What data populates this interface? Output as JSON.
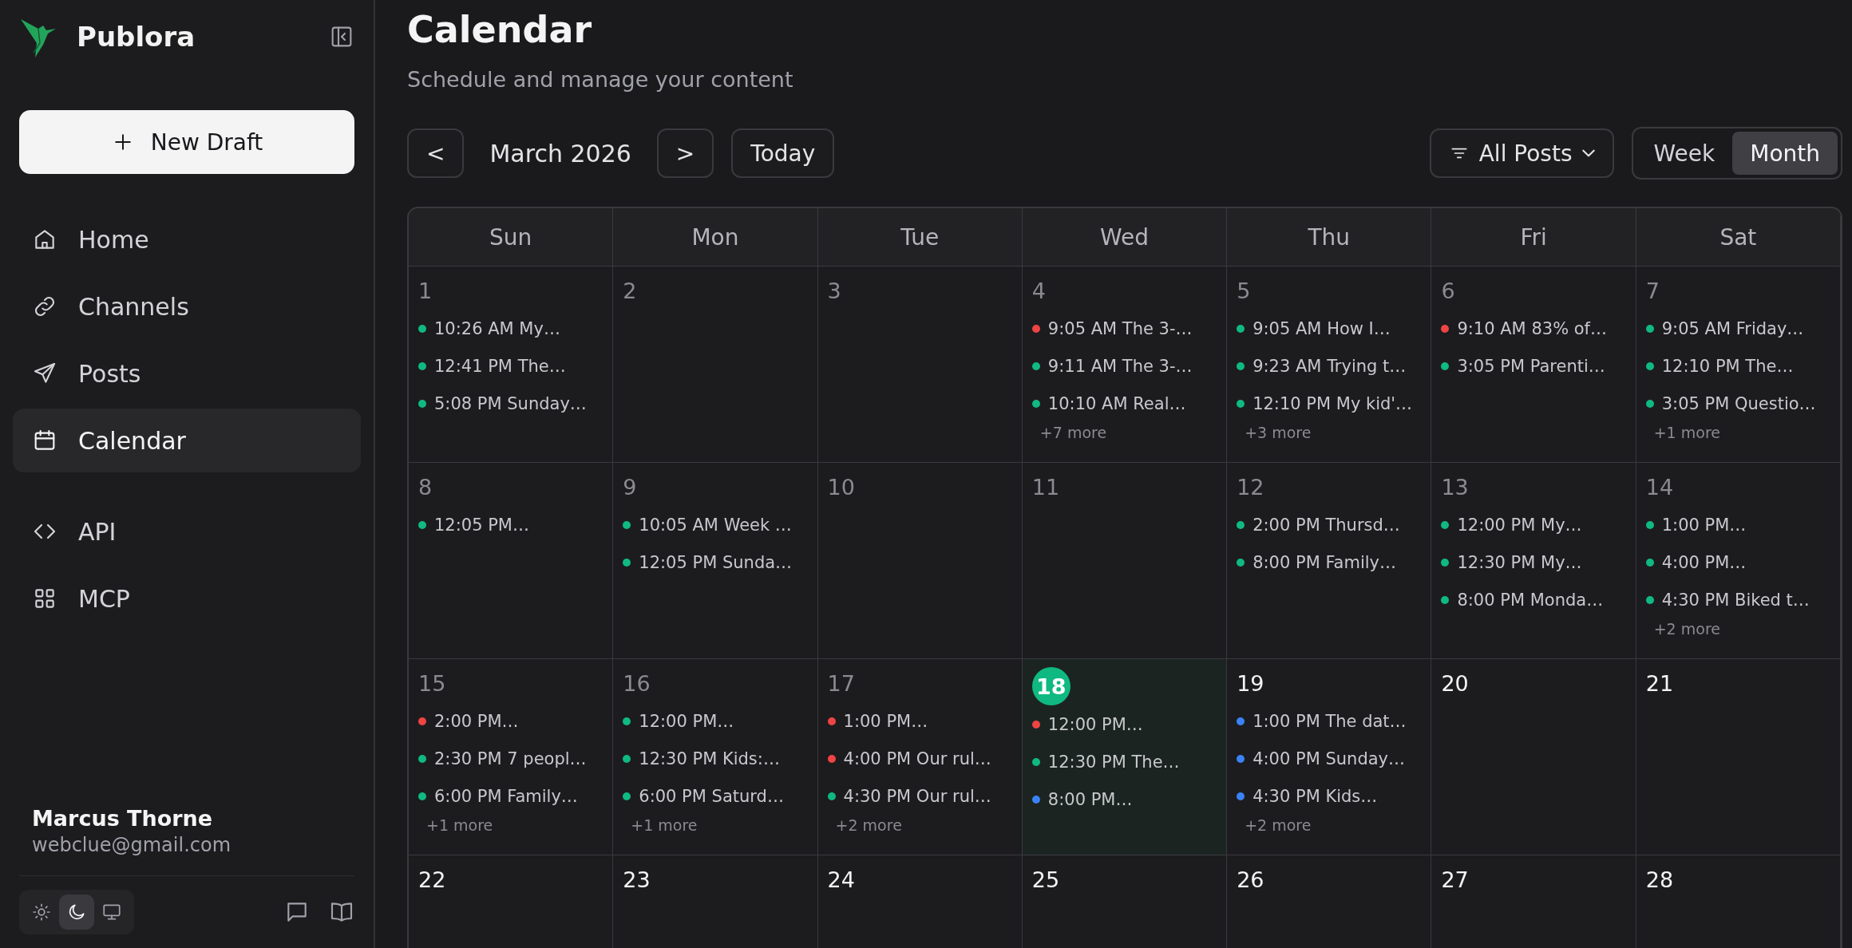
{
  "sidebar": {
    "brand": "Publora",
    "new_draft": "New Draft",
    "nav": [
      {
        "label": "Home",
        "selected": false
      },
      {
        "label": "Channels",
        "selected": false
      },
      {
        "label": "Posts",
        "selected": false
      },
      {
        "label": "Calendar",
        "selected": true
      },
      {
        "label": "API",
        "selected": false
      },
      {
        "label": "MCP",
        "selected": false
      }
    ],
    "user": {
      "name": "Marcus Thorne",
      "email": "webclue@gmail.com"
    },
    "theme_options": [
      {
        "selected": false
      },
      {
        "selected": true
      },
      {
        "selected": false
      }
    ]
  },
  "page": {
    "title": "Calendar",
    "subtitle": "Schedule and manage your content"
  },
  "toolbar": {
    "prev": "<",
    "month": "March 2026",
    "next": ">",
    "today": "Today",
    "filter": "All Posts",
    "views": [
      {
        "label": "Week",
        "selected": false
      },
      {
        "label": "Month",
        "selected": true
      }
    ]
  },
  "calendar": {
    "weekdays": [
      "Sun",
      "Mon",
      "Tue",
      "Wed",
      "Thu",
      "Fri",
      "Sat"
    ],
    "weeks": [
      [
        {
          "number": "1",
          "past": true,
          "today": false,
          "posts": [
            {
              "text": "10:26 AM My…",
              "color": "#10b981"
            },
            {
              "text": "12:41 PM The…",
              "color": "#10b981"
            },
            {
              "text": "5:08 PM Sunday…",
              "color": "#10b981"
            }
          ]
        },
        {
          "number": "2",
          "past": true,
          "today": false
        },
        {
          "number": "3",
          "past": true,
          "today": false
        },
        {
          "number": "4",
          "past": true,
          "today": false,
          "posts": [
            {
              "text": "9:05 AM The 3-…",
              "color": "#ef4444"
            },
            {
              "text": "9:11 AM The 3-…",
              "color": "#10b981"
            },
            {
              "text": "10:10 AM Real…",
              "color": "#10b981"
            }
          ],
          "more": "+7 more"
        },
        {
          "number": "5",
          "past": true,
          "today": false,
          "posts": [
            {
              "text": "9:05 AM How I…",
              "color": "#10b981"
            },
            {
              "text": "9:23 AM Trying t…",
              "color": "#10b981"
            },
            {
              "text": "12:10 PM My kid'…",
              "color": "#10b981"
            }
          ],
          "more": "+3 more"
        },
        {
          "number": "6",
          "past": true,
          "today": false,
          "posts": [
            {
              "text": "9:10 AM 83% of…",
              "color": "#ef4444"
            },
            {
              "text": "3:05 PM Parenti…",
              "color": "#10b981"
            }
          ]
        },
        {
          "number": "7",
          "past": true,
          "today": false,
          "posts": [
            {
              "text": "9:05 AM Friday…",
              "color": "#10b981"
            },
            {
              "text": "12:10 PM The…",
              "color": "#10b981"
            },
            {
              "text": "3:05 PM Questio…",
              "color": "#10b981"
            }
          ],
          "more": "+1 more"
        }
      ],
      [
        {
          "number": "8",
          "past": true,
          "today": false,
          "posts": [
            {
              "text": "12:05 PM…",
              "color": "#10b981"
            }
          ]
        },
        {
          "number": "9",
          "past": true,
          "today": false,
          "posts": [
            {
              "text": "10:05 AM Week …",
              "color": "#10b981"
            },
            {
              "text": "12:05 PM Sunda…",
              "color": "#10b981"
            }
          ]
        },
        {
          "number": "10",
          "past": true,
          "today": false
        },
        {
          "number": "11",
          "past": true,
          "today": false
        },
        {
          "number": "12",
          "past": true,
          "today": false,
          "posts": [
            {
              "text": "2:00 PM Thursd…",
              "color": "#10b981"
            },
            {
              "text": "8:00 PM Family…",
              "color": "#10b981"
            }
          ]
        },
        {
          "number": "13",
          "past": true,
          "today": false,
          "posts": [
            {
              "text": "12:00 PM My…",
              "color": "#10b981"
            },
            {
              "text": "12:30 PM My…",
              "color": "#10b981"
            },
            {
              "text": "8:00 PM Monda…",
              "color": "#10b981"
            }
          ]
        },
        {
          "number": "14",
          "past": true,
          "today": false,
          "posts": [
            {
              "text": "1:00 PM…",
              "color": "#10b981"
            },
            {
              "text": "4:00 PM…",
              "color": "#10b981"
            },
            {
              "text": "4:30 PM Biked t…",
              "color": "#10b981"
            }
          ],
          "more": "+2 more"
        }
      ],
      [
        {
          "number": "15",
          "past": true,
          "today": false,
          "posts": [
            {
              "text": "2:00 PM…",
              "color": "#ef4444"
            },
            {
              "text": "2:30 PM 7 peopl…",
              "color": "#10b981"
            },
            {
              "text": "6:00 PM Family…",
              "color": "#10b981"
            }
          ],
          "more": "+1 more"
        },
        {
          "number": "16",
          "past": true,
          "today": false,
          "posts": [
            {
              "text": "12:00 PM…",
              "color": "#10b981"
            },
            {
              "text": "12:30 PM Kids:…",
              "color": "#10b981"
            },
            {
              "text": "6:00 PM Saturd…",
              "color": "#10b981"
            }
          ],
          "more": "+1 more"
        },
        {
          "number": "17",
          "past": true,
          "today": false,
          "posts": [
            {
              "text": "1:00 PM…",
              "color": "#ef4444"
            },
            {
              "text": "4:00 PM Our rul…",
              "color": "#ef4444"
            },
            {
              "text": "4:30 PM Our rul…",
              "color": "#10b981"
            }
          ],
          "more": "+2 more"
        },
        {
          "number": "18",
          "past": false,
          "today": true,
          "posts": [
            {
              "text": "12:00 PM…",
              "color": "#ef4444"
            },
            {
              "text": "12:30 PM The…",
              "color": "#10b981"
            },
            {
              "text": "8:00 PM…",
              "color": "#3b82f6"
            }
          ]
        },
        {
          "number": "19",
          "past": false,
          "today": false,
          "posts": [
            {
              "text": "1:00 PM The dat…",
              "color": "#3b82f6"
            },
            {
              "text": "4:00 PM Sunday…",
              "color": "#3b82f6"
            },
            {
              "text": "4:30 PM Kids…",
              "color": "#3b82f6"
            }
          ],
          "more": "+2 more"
        },
        {
          "number": "20",
          "past": false,
          "today": false
        },
        {
          "number": "21",
          "past": false,
          "today": false
        }
      ],
      [
        {
          "number": "22",
          "past": false,
          "today": false
        },
        {
          "number": "23",
          "past": false,
          "today": false
        },
        {
          "number": "24",
          "past": false,
          "today": false
        },
        {
          "number": "25",
          "past": false,
          "today": false
        },
        {
          "number": "26",
          "past": false,
          "today": false
        },
        {
          "number": "27",
          "past": false,
          "today": false
        },
        {
          "number": "28",
          "past": false,
          "today": false
        }
      ]
    ]
  }
}
